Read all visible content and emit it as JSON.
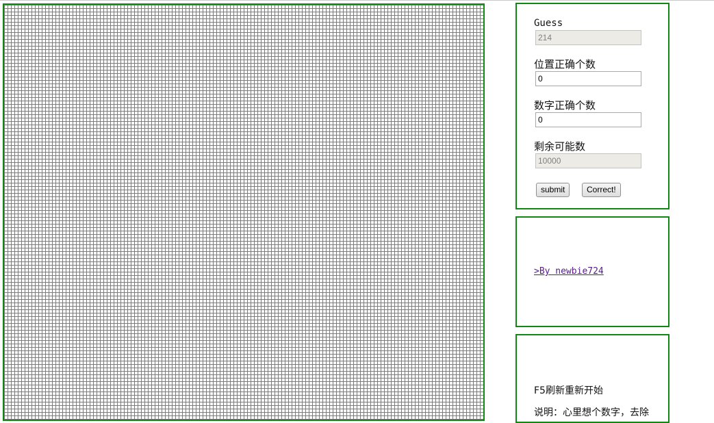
{
  "form": {
    "guess_label": "Guess",
    "guess_value": "214",
    "position_correct_label": "位置正确个数",
    "position_correct_value": "0",
    "digit_correct_label": "数字正确个数",
    "digit_correct_value": "0",
    "remaining_label": "剩余可能数",
    "remaining_value": "10000",
    "submit_label": "submit",
    "correct_label": "Correct!"
  },
  "credit": {
    "link_text": ">By newbie724"
  },
  "help": {
    "title": "F5刷新重新开始",
    "description": "说明：心里想个数字，去除"
  },
  "colors": {
    "panel_border": "#118811",
    "grid_line": "#7a7a7a",
    "link": "#551a8b"
  }
}
